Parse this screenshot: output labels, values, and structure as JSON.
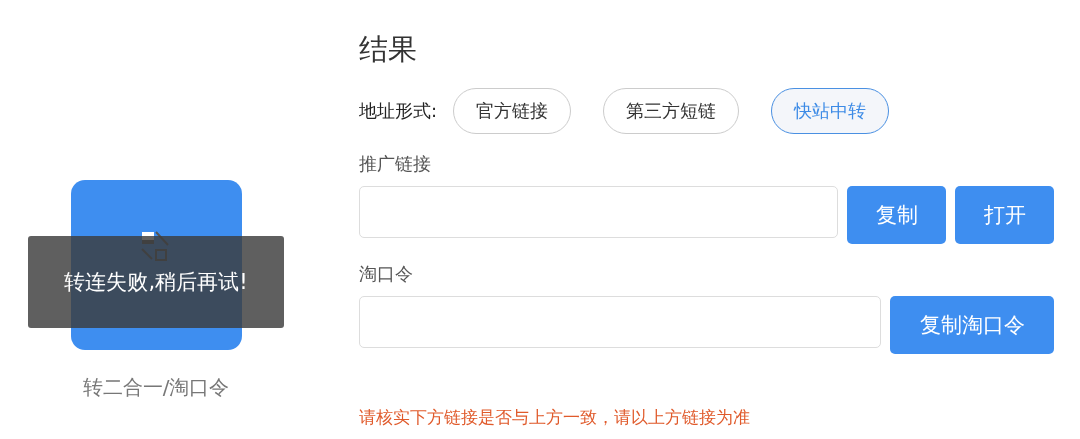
{
  "converter": {
    "caption": "转二合一/淘口令"
  },
  "toast": {
    "message": "转连失败,稍后再试!"
  },
  "results": {
    "title": "结果",
    "format_label": "地址形式:",
    "formats": [
      {
        "label": "官方链接",
        "selected": false
      },
      {
        "label": "第三方短链",
        "selected": false
      },
      {
        "label": "快站中转",
        "selected": true
      }
    ],
    "promo_link": {
      "label": "推广链接",
      "buttons": [
        "复制",
        "打开"
      ]
    },
    "tao_code": {
      "label": "淘口令",
      "buttons": [
        "复制淘口令"
      ]
    },
    "warning": "请核实下方链接是否与上方一致，请以上方链接为准"
  }
}
